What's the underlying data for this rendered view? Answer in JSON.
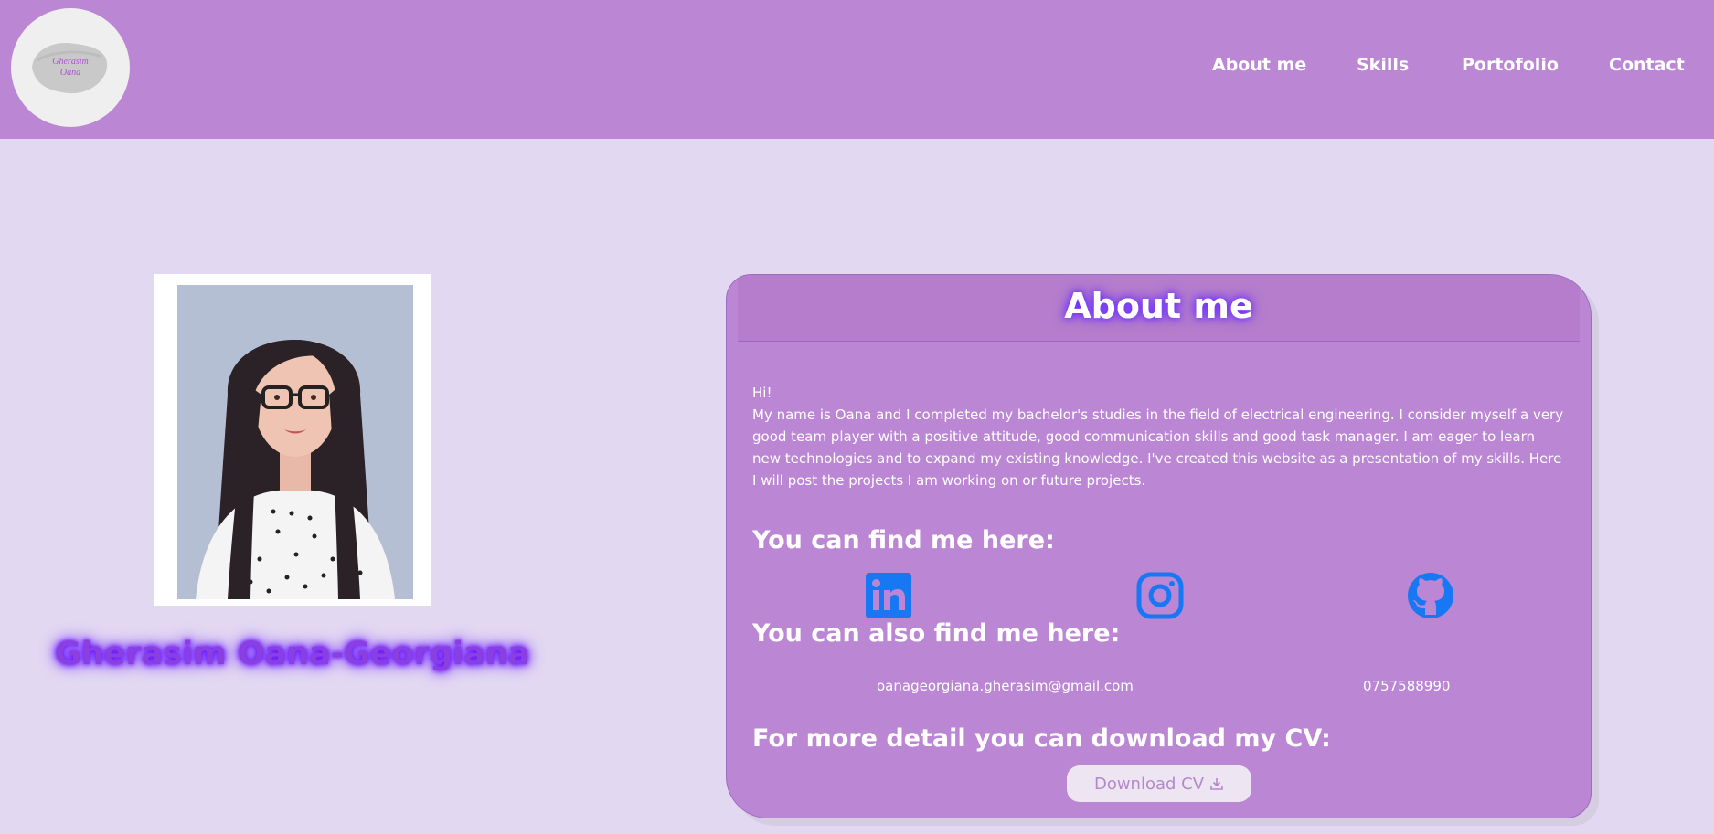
{
  "logo": {
    "text_line1": "Gherasim",
    "text_line2": "Oana"
  },
  "nav": {
    "items": [
      {
        "label": "About me"
      },
      {
        "label": "Skills"
      },
      {
        "label": "Portofolio"
      },
      {
        "label": "Contact"
      }
    ]
  },
  "profile": {
    "name": "Gherasim Oana-Georgiana"
  },
  "about": {
    "title": "About me",
    "greeting": "Hi!",
    "body": "My name is Oana and I completed my bachelor's studies in the field of electrical engineering. I consider myself a very good team player with a positive attitude, good communication skills and good task manager. I am eager to learn new technologies and to expand my existing knowledge. I've created this website as a presentation of my skills. Here I will post the projects I am working on or future projects.",
    "find_me_heading": "You can find me here:",
    "social": [
      {
        "icon": "linkedin-icon"
      },
      {
        "icon": "instagram-icon"
      },
      {
        "icon": "github-icon"
      }
    ],
    "also_find_heading": "You can also find me here:",
    "email": "oanageorgiana.gherasim@gmail.com",
    "phone": "0757588990",
    "cv_heading": "For more detail you can download my CV:",
    "cv_button_label": "Download CV"
  },
  "colors": {
    "navbar": "#bb86d3",
    "page_background": "#e2d8f2",
    "card": "#bb86d3",
    "social_icon": "#1877f2",
    "name_glow": "#7a2cff"
  }
}
